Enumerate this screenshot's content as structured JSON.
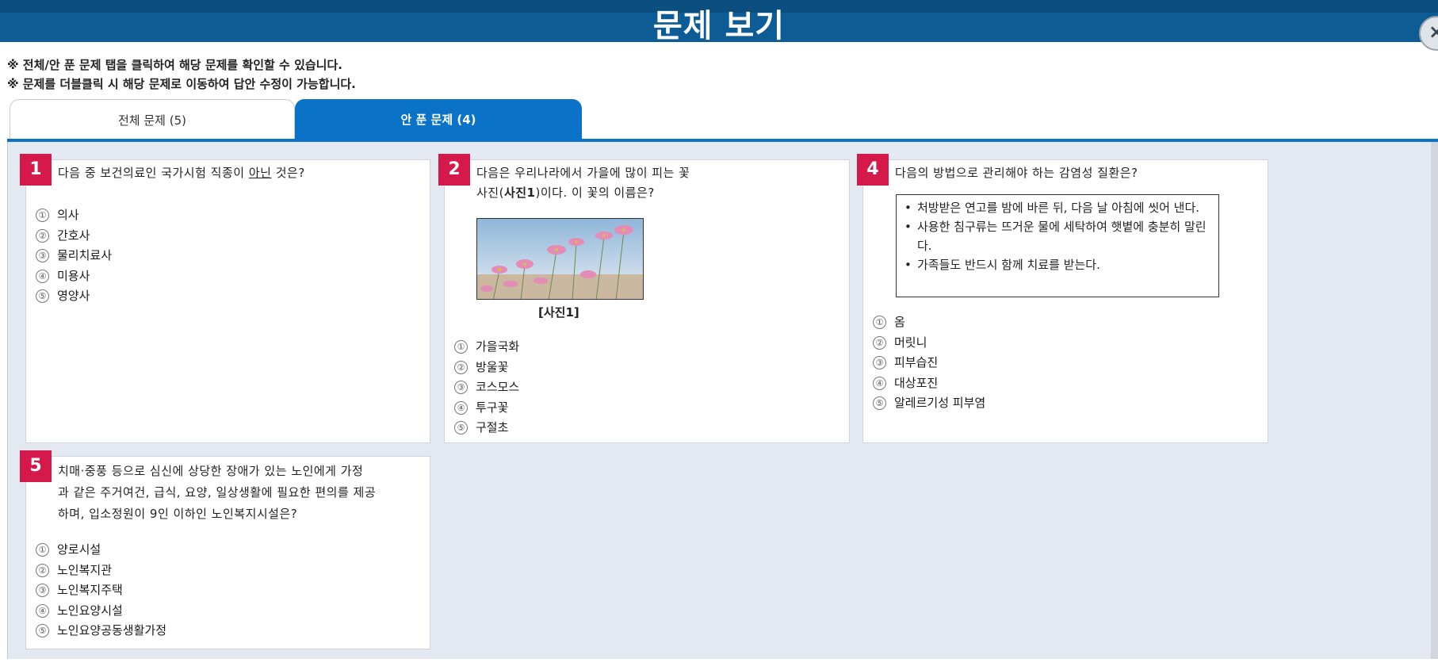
{
  "window": {
    "title": "문제 보기",
    "close_label": "×"
  },
  "notices": [
    "※ 전체/안 푼 문제 탭을 클릭하여 해당 문제를 확인할 수 있습니다.",
    "※ 문제를 더블클릭 시 해당 문제로 이동하여 답안 수정이 가능합니다."
  ],
  "tabs": [
    {
      "label": "전체 문제 (5)",
      "active": false
    },
    {
      "label": "안 푼 문제 (4)",
      "active": true
    }
  ],
  "questions": [
    {
      "number": "1",
      "text_before": "다음 중 보건의료인 국가시험 직종이 ",
      "text_underline": "아닌",
      "text_after": " 것은?",
      "options": [
        "의사",
        "간호사",
        "물리치료사",
        "미용사",
        "영양사"
      ]
    },
    {
      "number": "2",
      "text_line1": "다음은 우리나라에서 가을에 많이 피는 꽃",
      "text_line2_a": "사진(",
      "text_line2_bold": "사진1",
      "text_line2_b": ")이다. 이 꽃의 이름은?",
      "caption": "[사진1]",
      "options": [
        "가을국화",
        "방울꽃",
        "코스모스",
        "투구꽃",
        "구절초"
      ]
    },
    {
      "number": "4",
      "text": "다음의 방법으로 관리해야 하는 감염성 질환은?",
      "box_items": [
        "처방받은 연고를 밤에 바른 뒤, 다음 날 아침에 씻어 낸다.",
        "사용한 침구류는 뜨거운 물에 세탁하여 햇볕에 충분히 말린다.",
        "가족들도 반드시 함께 치료를 받는다."
      ],
      "options": [
        "옴",
        "머릿니",
        "피부습진",
        "대상포진",
        "알레르기성 피부염"
      ]
    },
    {
      "number": "5",
      "text_lines": [
        "치매·중풍 등으로 심신에 상당한 장애가 있는 노인에게 가정",
        "과 같은 주거여건, 급식, 요양, 일상생활에 필요한 편의를 제공",
        "하며, 입소정원이 9인 이하인 노인복지시설은?"
      ],
      "options": [
        "양로시설",
        "노인복지관",
        "노인복지주택",
        "노인요양시설",
        "노인요양공동생활가정"
      ]
    }
  ],
  "option_marks": [
    "①",
    "②",
    "③",
    "④",
    "⑤"
  ]
}
